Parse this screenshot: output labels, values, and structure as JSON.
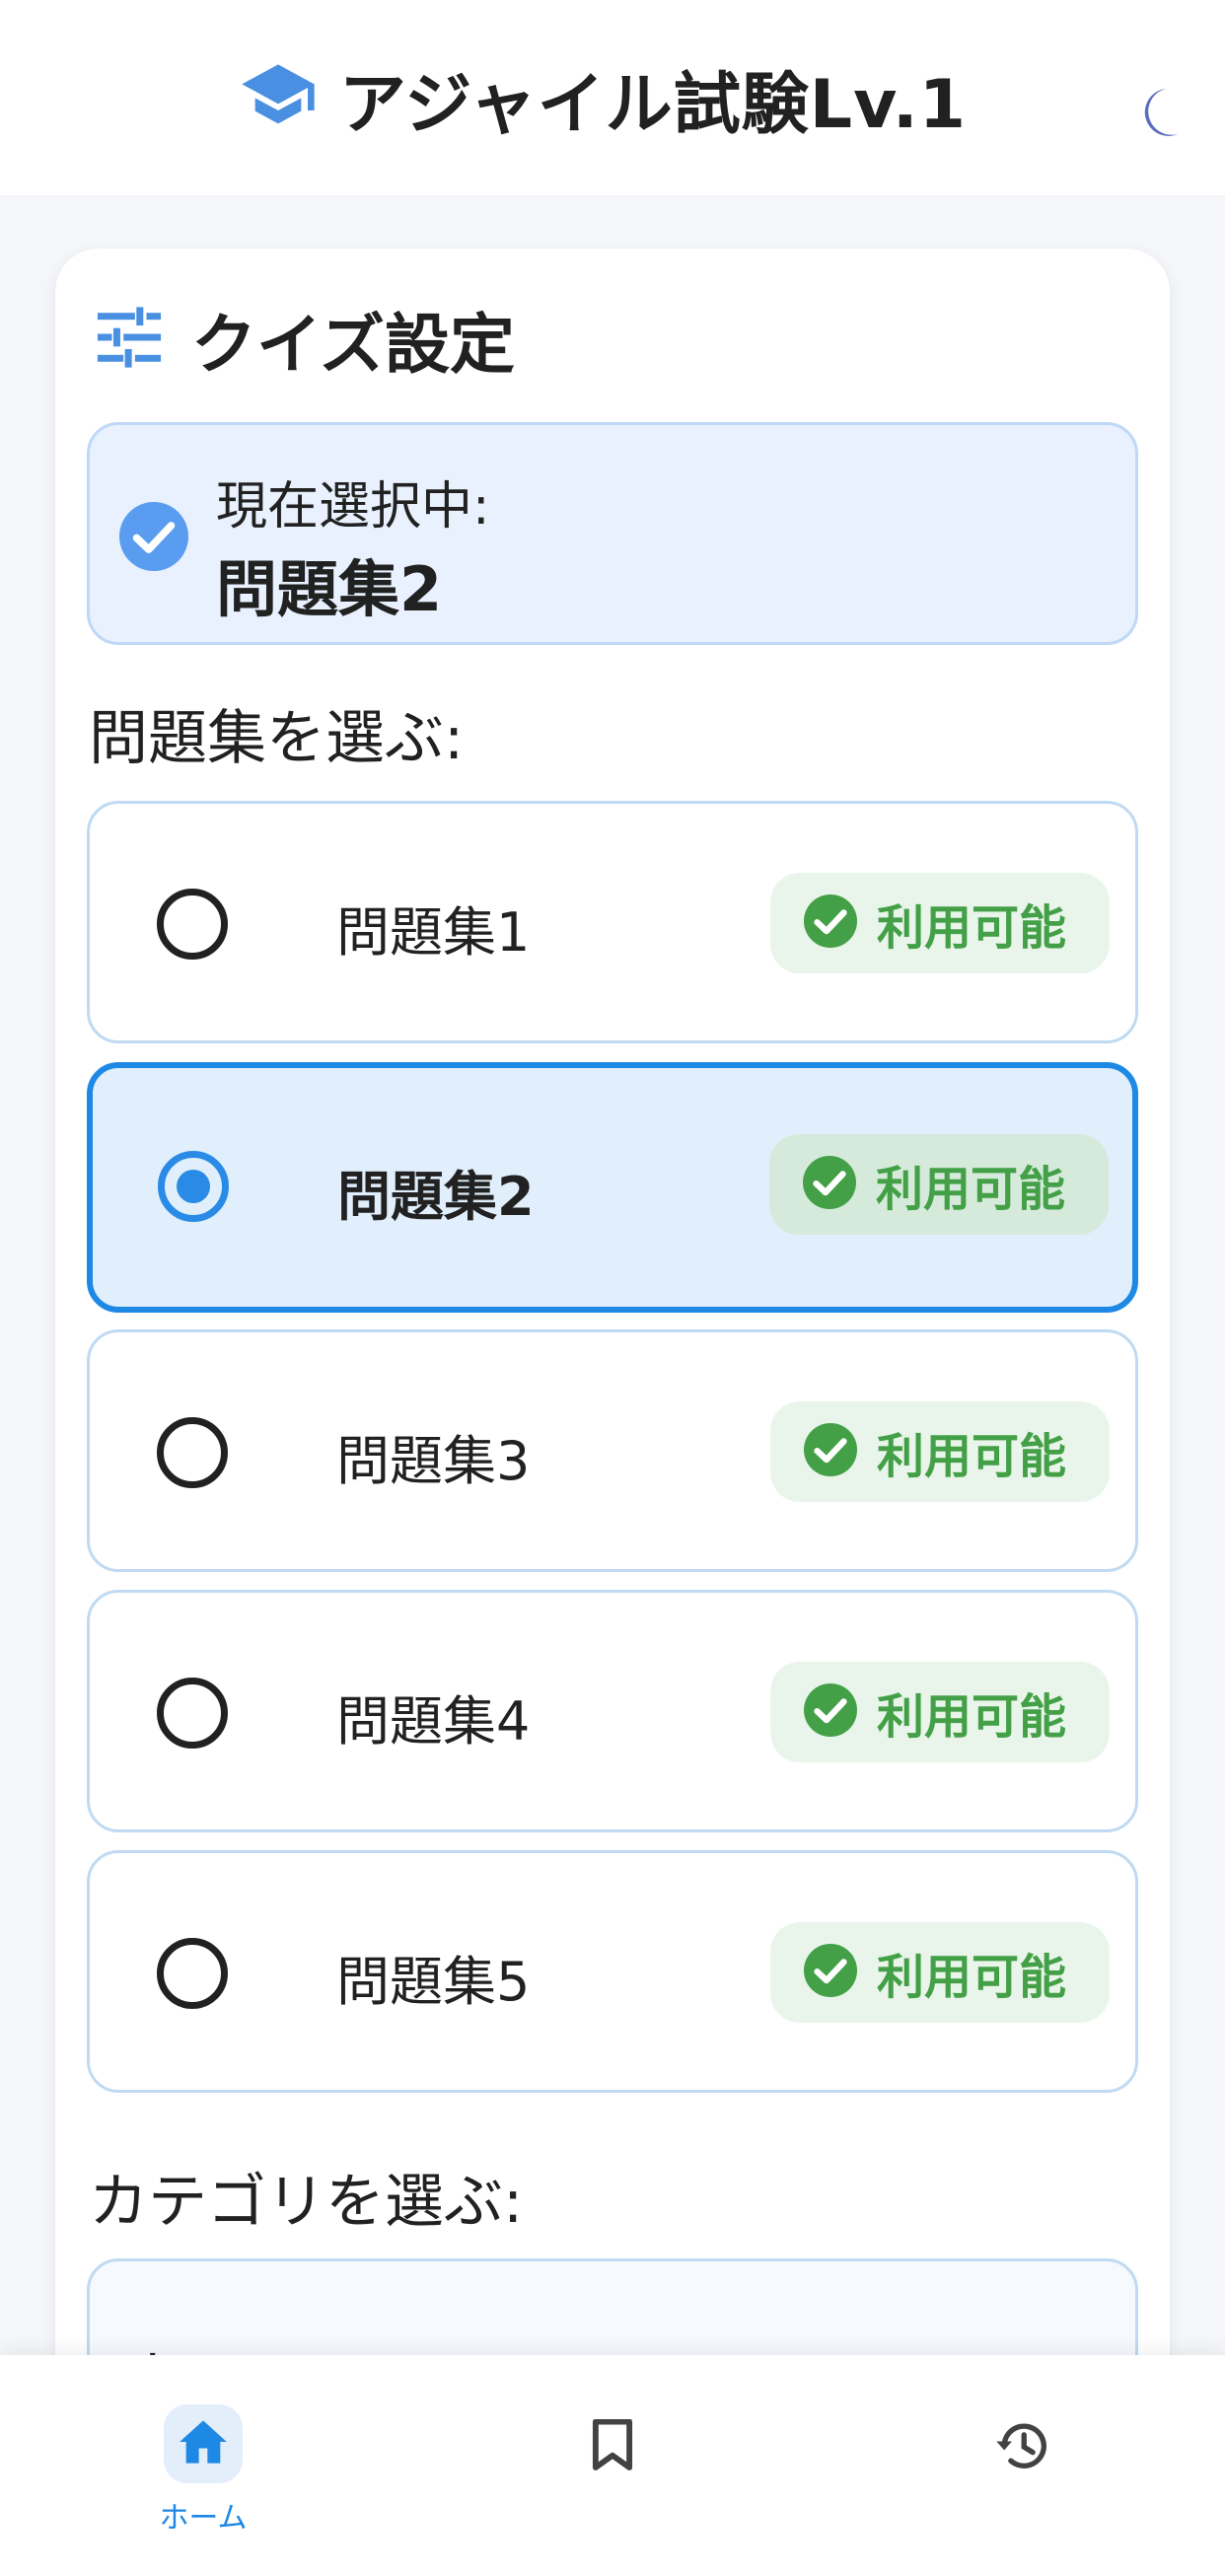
{
  "header": {
    "title": "アジャイル試験Lv.1",
    "logo_icon": "graduation-cap-icon",
    "theme_toggle_icon": "moon-icon"
  },
  "settings": {
    "title": "クイズ設定",
    "title_icon": "tune-sliders-icon",
    "current": {
      "label": "現在選択中:",
      "value": "問題集2"
    },
    "problem_set_section_label": "問題集を選ぶ:",
    "problem_sets": [
      {
        "label": "問題集1",
        "badge": "利用可能",
        "selected": false
      },
      {
        "label": "問題集2",
        "badge": "利用可能",
        "selected": true
      },
      {
        "label": "問題集3",
        "badge": "利用可能",
        "selected": false
      },
      {
        "label": "問題集4",
        "badge": "利用可能",
        "selected": false
      },
      {
        "label": "問題集5",
        "badge": "利用可能",
        "selected": false
      }
    ],
    "category_section_label": "カテゴリを選ぶ:",
    "category_select_value": "すべて"
  },
  "bottom_nav": {
    "items": [
      {
        "icon": "home-icon",
        "label": "ホーム",
        "active": true
      },
      {
        "icon": "bookmark-icon",
        "label": "",
        "active": false
      },
      {
        "icon": "history-icon",
        "label": "",
        "active": false
      }
    ]
  },
  "colors": {
    "accent": "#1e88e5",
    "success": "#43a047",
    "moon": "#5c6bc0"
  }
}
